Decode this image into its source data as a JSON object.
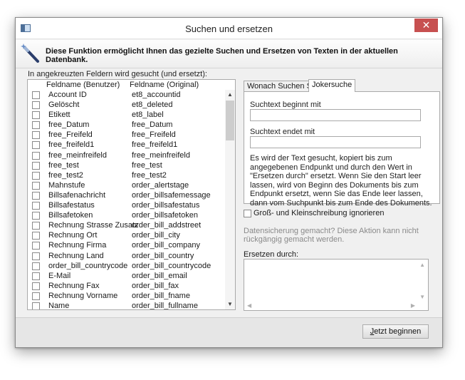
{
  "window": {
    "title": "Suchen und ersetzen",
    "close_label": "✕"
  },
  "intro": "Diese Funktion ermöglicht Ihnen das gezielte Suchen und Ersetzen von Texten in der aktuellen Datenbank.",
  "fields_label": "In angekreuzten Feldern wird gesucht (und ersetzt):",
  "grid": {
    "columns": [
      "Feldname (Benutzer)",
      "Feldname (Original)"
    ],
    "rows": [
      {
        "user": "Account ID",
        "original": "et8_accountid"
      },
      {
        "user": "Gelöscht",
        "original": "et8_deleted"
      },
      {
        "user": "Etikett",
        "original": "et8_label"
      },
      {
        "user": "free_Datum",
        "original": "free_Datum"
      },
      {
        "user": "free_Freifeld",
        "original": "free_Freifeld"
      },
      {
        "user": "free_freifeld1",
        "original": "free_freifeld1"
      },
      {
        "user": "free_meinfreifeld",
        "original": "free_meinfreifeld"
      },
      {
        "user": "free_test",
        "original": "free_test"
      },
      {
        "user": "free_test2",
        "original": "free_test2"
      },
      {
        "user": "Mahnstufe",
        "original": "order_alertstage"
      },
      {
        "user": "Billsafenachricht",
        "original": "order_billsafemessage"
      },
      {
        "user": "Billsafestatus",
        "original": "order_billsafestatus"
      },
      {
        "user": "Billsafetoken",
        "original": "order_billsafetoken"
      },
      {
        "user": "Rechnung Strasse Zusatz",
        "original": "order_bill_addstreet"
      },
      {
        "user": "Rechnung Ort",
        "original": "order_bill_city"
      },
      {
        "user": "Rechnung Firma",
        "original": "order_bill_company"
      },
      {
        "user": "Rechnung Land",
        "original": "order_bill_country"
      },
      {
        "user": "order_bill_countrycode",
        "original": "order_bill_countrycode"
      },
      {
        "user": "E-Mail",
        "original": "order_bill_email"
      },
      {
        "user": "Rechnung Fax",
        "original": "order_bill_fax"
      },
      {
        "user": "Rechnung Vorname",
        "original": "order_bill_fname"
      },
      {
        "user": "Name",
        "original": "order_bill_fullname"
      }
    ]
  },
  "tabs": [
    {
      "label": "Wonach Suchen Sie?",
      "active": false
    },
    {
      "label": "Jokersuche",
      "active": true
    }
  ],
  "joker": {
    "start_label": "Suchtext beginnt mit",
    "end_label": "Suchtext endet mit",
    "help": "Es wird der Text gesucht, kopiert bis zum angegebenen Endpunkt und durch den Wert in \"Ersetzen durch\" ersetzt. Wenn Sie den Start leer lassen, wird von Beginn des Dokuments bis zum Endpunkt ersetzt, wenn Sie das Ende leer lassen, dann vom Suchpunkt bis zum Ende des Dokuments."
  },
  "case_label": "Groß- und Kleinschreibung ignorieren",
  "notice": "Datensicherung gemacht? Diese Aktion kann nicht rückgängig gemacht werden.",
  "replace_label": "Ersetzen durch:",
  "start_button": {
    "mnemonic": "J",
    "rest": "etzt beginnen"
  },
  "colors": {
    "close": "#c75050",
    "window_bg": "#f0f0f0"
  }
}
